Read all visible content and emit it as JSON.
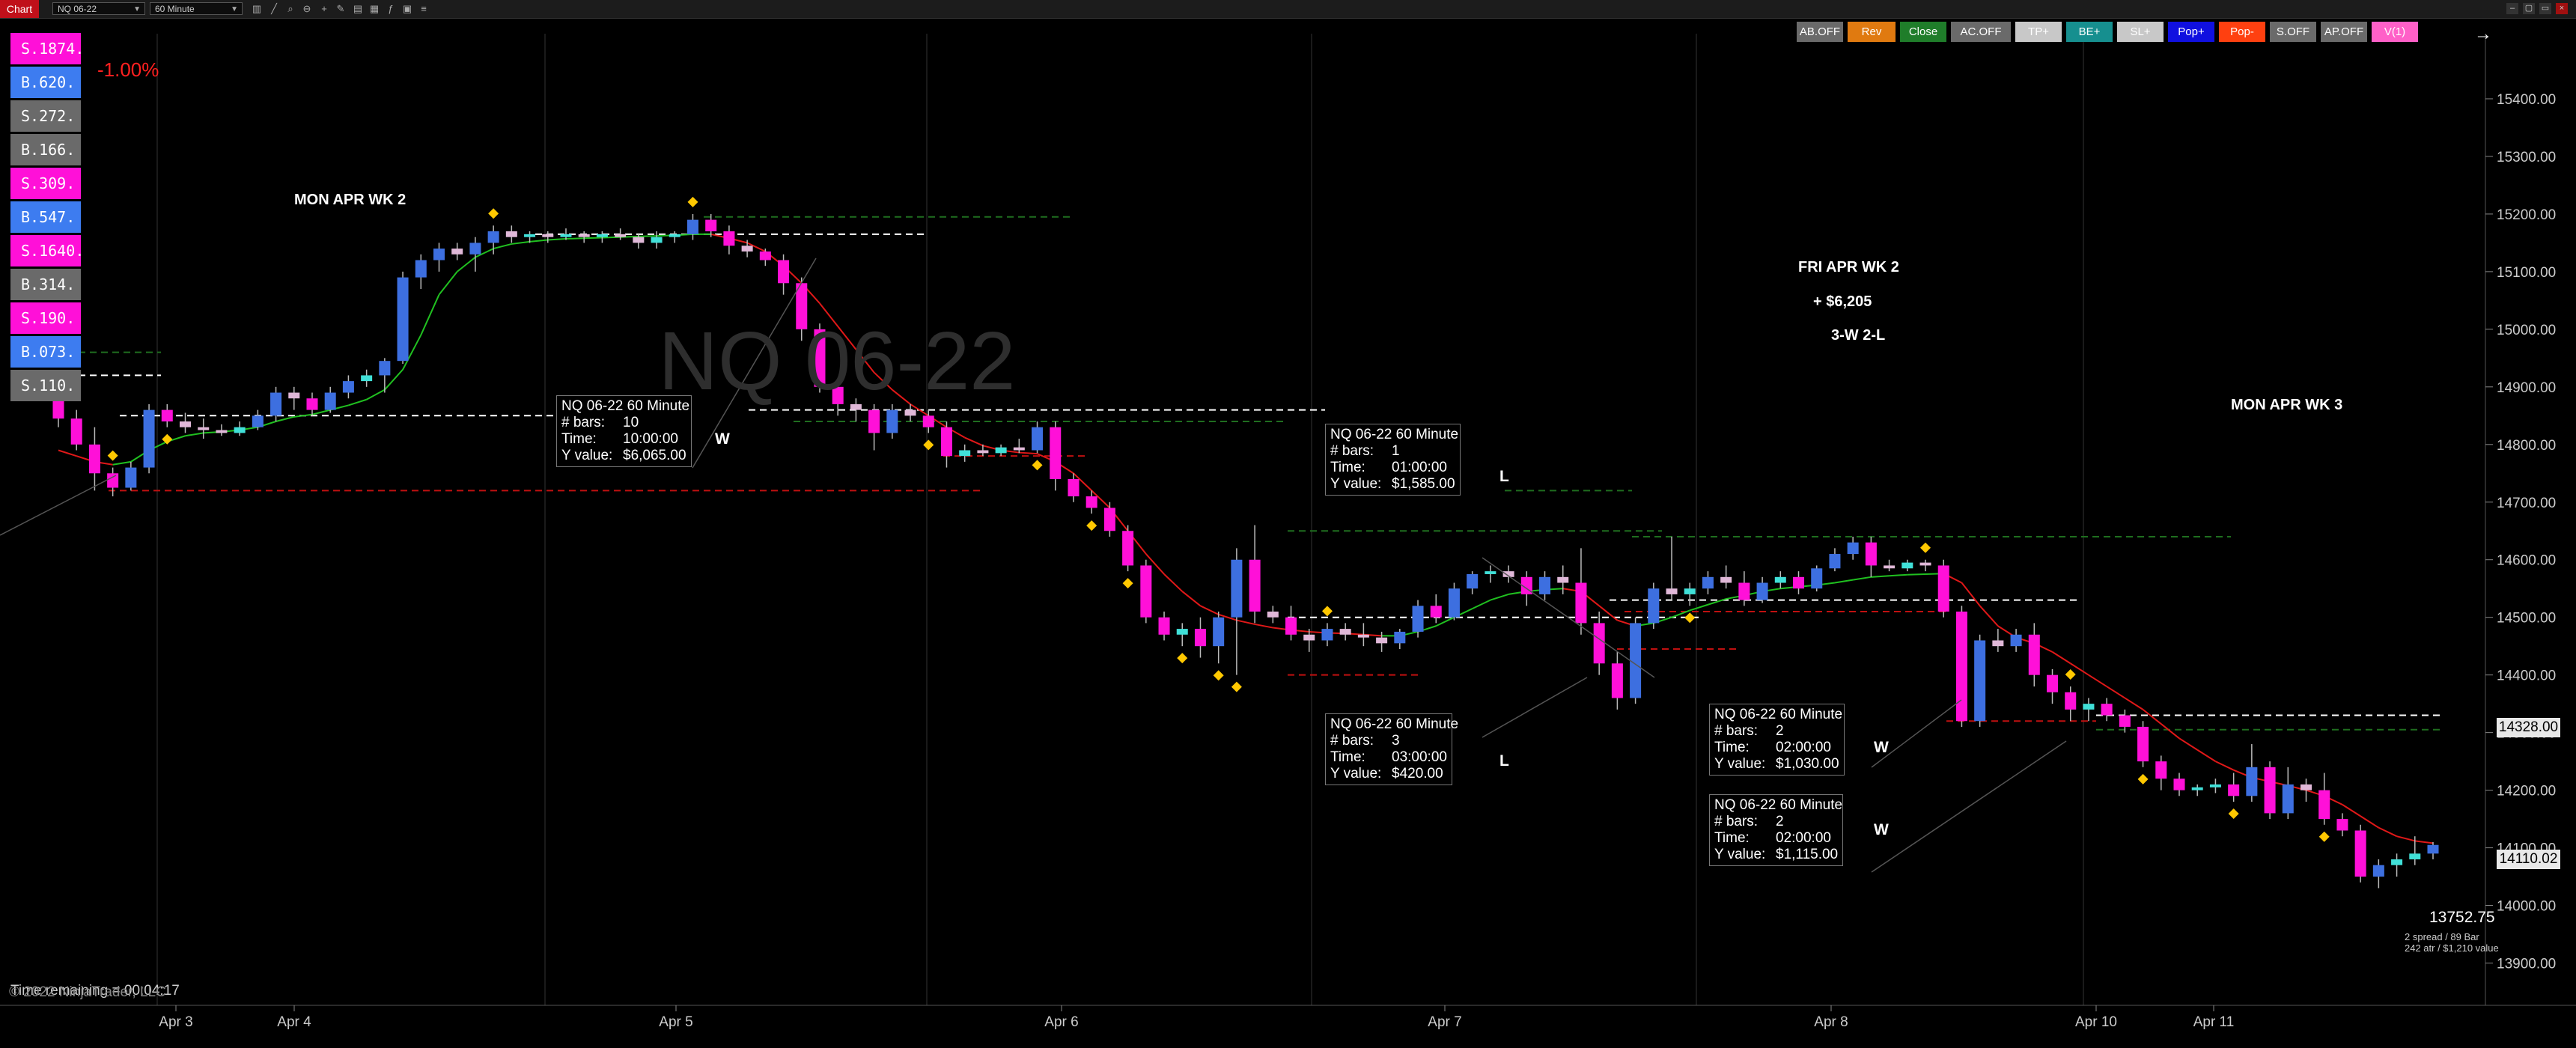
{
  "toolbar": {
    "tab": "Chart",
    "instrument": "NQ 06-22",
    "interval": "60 Minute"
  },
  "watermark": "NQ 06-22",
  "pnl_pct": "-1.00%",
  "positions": [
    {
      "label": "S.1874.",
      "color": "#ff10d8"
    },
    {
      "label": "B.620.",
      "color": "#3d7cf0"
    },
    {
      "label": "S.272.",
      "color": "#6a6a6a"
    },
    {
      "label": "B.166.",
      "color": "#6a6a6a"
    },
    {
      "label": "S.309.",
      "color": "#ff10d8"
    },
    {
      "label": "B.547.",
      "color": "#3d7cf0"
    },
    {
      "label": "S.1640.",
      "color": "#ff10d8"
    },
    {
      "label": "B.314.",
      "color": "#6a6a6a"
    },
    {
      "label": "S.190.",
      "color": "#ff10d8"
    },
    {
      "label": "B.073.",
      "color": "#3d7cf0"
    },
    {
      "label": "S.110.",
      "color": "#6a6a6a"
    }
  ],
  "trade_buttons": [
    {
      "label": "AB.OFF",
      "color": "#6a6a6a"
    },
    {
      "label": "Rev",
      "color": "#e07a10"
    },
    {
      "label": "Close",
      "color": "#1f7d2a"
    },
    {
      "label": "AC.OFF",
      "color": "#6a6a6a"
    },
    {
      "label": "TP+",
      "color": "#c8c8c8"
    },
    {
      "label": "BE+",
      "color": "#168f8f"
    },
    {
      "label": "SL+",
      "color": "#c8c8c8"
    },
    {
      "label": "Pop+",
      "color": "#1010e0"
    },
    {
      "label": "Pop-",
      "color": "#ff4010"
    },
    {
      "label": "S.OFF",
      "color": "#6a6a6a"
    },
    {
      "label": "AP.OFF",
      "color": "#6a6a6a"
    },
    {
      "label": "V(1)",
      "color": "#ff60c8"
    }
  ],
  "arrow_icon": "right-arrow",
  "notes": {
    "mon_apr_wk2": "MON APR WK 2",
    "fri_apr_wk2": "FRI APR WK 2",
    "fri_pnl": "+ $6,205",
    "fri_score": "3-W 2-L",
    "mon_apr_wk3": "MON APR WK 3"
  },
  "tooltips": [
    {
      "title": "NQ 06-22 60 Minute",
      "bars_label": "# bars:",
      "bars": "10",
      "time_label": "Time:",
      "time": "10:00:00",
      "y_label": "Y value:",
      "y": "$6,065.00",
      "result": "W"
    },
    {
      "title": "NQ 06-22 60 Minute",
      "bars_label": "# bars:",
      "bars": "1",
      "time_label": "Time:",
      "time": "01:00:00",
      "y_label": "Y value:",
      "y": "$1,585.00",
      "result": "L"
    },
    {
      "title": "NQ 06-22 60 Minute",
      "bars_label": "# bars:",
      "bars": "3",
      "time_label": "Time:",
      "time": "03:00:00",
      "y_label": "Y value:",
      "y": "$420.00",
      "result": "L"
    },
    {
      "title": "NQ 06-22 60 Minute",
      "bars_label": "# bars:",
      "bars": "2",
      "time_label": "Time:",
      "time": "02:00:00",
      "y_label": "Y value:",
      "y": "$1,030.00",
      "result": "W"
    },
    {
      "title": "NQ 06-22 60 Minute",
      "bars_label": "# bars:",
      "bars": "2",
      "time_label": "Time:",
      "time": "02:00:00",
      "y_label": "Y value:",
      "y": "$1,115.00",
      "result": "W"
    }
  ],
  "price_tags": {
    "level_1": "14328.00",
    "current": "14110.02",
    "low": "13752.75",
    "spread_info": "2 spread / 89 Bar",
    "atr_info": "242 atr / $1,210 value"
  },
  "footer": {
    "time_remaining": "Time remaining = 00:04:17",
    "copyright": "© 2022 NinjaTrader, LLC"
  },
  "colors": {
    "bull": "#3d6fe0",
    "bull_light": "#40e0d8",
    "bear": "#ff10d8",
    "bear_light": "#e0b8d8",
    "ema_red": "#e01818",
    "ema_green": "#20c020",
    "signal": "#ffc800"
  },
  "chart_data": {
    "type": "candlestick",
    "x_tick_labels": [
      "Apr 3",
      "Apr 4",
      "Apr 5",
      "Apr 6",
      "Apr 7",
      "Apr 8",
      "Apr 10",
      "Apr 11"
    ],
    "y_range": [
      13850,
      15500
    ],
    "y_tick_labels": [
      "15400.00",
      "15300.00",
      "15200.00",
      "15100.00",
      "15000.00",
      "14900.00",
      "14800.00",
      "14700.00",
      "14600.00",
      "14500.00",
      "14400.00",
      "14300.00",
      "14200.00",
      "14100.00",
      "14000.00",
      "13900.00"
    ],
    "grid": false,
    "candles": [
      [
        14880,
        14895,
        14830,
        14845
      ],
      [
        14845,
        14860,
        14790,
        14800
      ],
      [
        14800,
        14830,
        14720,
        14750
      ],
      [
        14750,
        14760,
        14710,
        14725
      ],
      [
        14725,
        14770,
        14720,
        14760
      ],
      [
        14760,
        14870,
        14750,
        14860
      ],
      [
        14860,
        14870,
        14830,
        14840
      ],
      [
        14840,
        14855,
        14820,
        14830
      ],
      [
        14830,
        14845,
        14810,
        14825
      ],
      [
        14825,
        14835,
        14815,
        14820
      ],
      [
        14820,
        14840,
        14815,
        14830
      ],
      [
        14830,
        14860,
        14825,
        14850
      ],
      [
        14850,
        14900,
        14840,
        14890
      ],
      [
        14890,
        14900,
        14860,
        14880
      ],
      [
        14880,
        14890,
        14850,
        14860
      ],
      [
        14860,
        14900,
        14855,
        14890
      ],
      [
        14890,
        14920,
        14880,
        14910
      ],
      [
        14910,
        14930,
        14900,
        14920
      ],
      [
        14920,
        14950,
        14890,
        14945
      ],
      [
        14945,
        15100,
        14940,
        15090
      ],
      [
        15090,
        15130,
        15070,
        15120
      ],
      [
        15120,
        15150,
        15100,
        15140
      ],
      [
        15140,
        15150,
        15120,
        15130
      ],
      [
        15130,
        15160,
        15100,
        15150
      ],
      [
        15150,
        15180,
        15130,
        15170
      ],
      [
        15170,
        15180,
        15150,
        15160
      ],
      [
        15160,
        15170,
        15150,
        15165
      ],
      [
        15165,
        15170,
        15150,
        15160
      ],
      [
        15160,
        15175,
        15155,
        15165
      ],
      [
        15165,
        15170,
        15150,
        15160
      ],
      [
        15160,
        15170,
        15150,
        15165
      ],
      [
        15165,
        15175,
        15155,
        15160
      ],
      [
        15160,
        15165,
        15140,
        15150
      ],
      [
        15150,
        15170,
        15140,
        15160
      ],
      [
        15160,
        15170,
        15150,
        15165
      ],
      [
        15165,
        15200,
        15155,
        15190
      ],
      [
        15190,
        15200,
        15160,
        15170
      ],
      [
        15170,
        15180,
        15130,
        15145
      ],
      [
        15145,
        15155,
        15125,
        15135
      ],
      [
        15135,
        15140,
        15110,
        15120
      ],
      [
        15120,
        15130,
        15060,
        15080
      ],
      [
        15080,
        15090,
        14980,
        15000
      ],
      [
        15000,
        15010,
        14890,
        14900
      ],
      [
        14900,
        14910,
        14850,
        14870
      ],
      [
        14870,
        14880,
        14840,
        14860
      ],
      [
        14860,
        14870,
        14790,
        14820
      ],
      [
        14820,
        14870,
        14810,
        14860
      ],
      [
        14860,
        14870,
        14840,
        14850
      ],
      [
        14850,
        14860,
        14820,
        14830
      ],
      [
        14830,
        14840,
        14760,
        14780
      ],
      [
        14780,
        14800,
        14770,
        14790
      ],
      [
        14790,
        14800,
        14780,
        14785
      ],
      [
        14785,
        14800,
        14780,
        14795
      ],
      [
        14795,
        14810,
        14785,
        14790
      ],
      [
        14790,
        14840,
        14785,
        14830
      ],
      [
        14830,
        14840,
        14720,
        14740
      ],
      [
        14740,
        14750,
        14700,
        14710
      ],
      [
        14710,
        14720,
        14680,
        14690
      ],
      [
        14690,
        14700,
        14640,
        14650
      ],
      [
        14650,
        14660,
        14580,
        14590
      ],
      [
        14590,
        14600,
        14490,
        14500
      ],
      [
        14500,
        14510,
        14460,
        14470
      ],
      [
        14470,
        14490,
        14450,
        14480
      ],
      [
        14480,
        14500,
        14430,
        14450
      ],
      [
        14450,
        14510,
        14420,
        14500
      ],
      [
        14500,
        14620,
        14400,
        14600
      ],
      [
        14600,
        14660,
        14490,
        14510
      ],
      [
        14510,
        14520,
        14490,
        14500
      ],
      [
        14500,
        14520,
        14460,
        14470
      ],
      [
        14470,
        14480,
        14440,
        14460
      ],
      [
        14460,
        14490,
        14450,
        14480
      ],
      [
        14480,
        14490,
        14460,
        14470
      ],
      [
        14470,
        14490,
        14450,
        14465
      ],
      [
        14465,
        14475,
        14440,
        14455
      ],
      [
        14455,
        14480,
        14445,
        14475
      ],
      [
        14475,
        14530,
        14465,
        14520
      ],
      [
        14520,
        14540,
        14490,
        14500
      ],
      [
        14500,
        14560,
        14495,
        14550
      ],
      [
        14550,
        14580,
        14540,
        14575
      ],
      [
        14575,
        14590,
        14560,
        14580
      ],
      [
        14580,
        14590,
        14560,
        14570
      ],
      [
        14570,
        14580,
        14520,
        14540
      ],
      [
        14540,
        14580,
        14530,
        14570
      ],
      [
        14570,
        14590,
        14540,
        14560
      ],
      [
        14560,
        14620,
        14470,
        14490
      ],
      [
        14490,
        14510,
        14400,
        14420
      ],
      [
        14420,
        14440,
        14340,
        14360
      ],
      [
        14360,
        14500,
        14350,
        14490
      ],
      [
        14490,
        14560,
        14480,
        14550
      ],
      [
        14550,
        14640,
        14530,
        14540
      ],
      [
        14540,
        14560,
        14520,
        14550
      ],
      [
        14550,
        14580,
        14540,
        14570
      ],
      [
        14570,
        14590,
        14550,
        14560
      ],
      [
        14560,
        14580,
        14520,
        14530
      ],
      [
        14530,
        14570,
        14525,
        14560
      ],
      [
        14560,
        14580,
        14550,
        14570
      ],
      [
        14570,
        14580,
        14540,
        14550
      ],
      [
        14550,
        14590,
        14545,
        14585
      ],
      [
        14585,
        14620,
        14580,
        14610
      ],
      [
        14610,
        14640,
        14600,
        14630
      ],
      [
        14630,
        14640,
        14570,
        14590
      ],
      [
        14590,
        14600,
        14580,
        14585
      ],
      [
        14585,
        14600,
        14580,
        14595
      ],
      [
        14595,
        14600,
        14580,
        14590
      ],
      [
        14590,
        14600,
        14500,
        14510
      ],
      [
        14510,
        14520,
        14310,
        14320
      ],
      [
        14320,
        14470,
        14310,
        14460
      ],
      [
        14460,
        14480,
        14440,
        14450
      ],
      [
        14450,
        14480,
        14440,
        14470
      ],
      [
        14470,
        14490,
        14380,
        14400
      ],
      [
        14400,
        14410,
        14350,
        14370
      ],
      [
        14370,
        14380,
        14320,
        14340
      ],
      [
        14340,
        14360,
        14320,
        14350
      ],
      [
        14350,
        14360,
        14320,
        14330
      ],
      [
        14330,
        14340,
        14300,
        14310
      ],
      [
        14310,
        14320,
        14240,
        14250
      ],
      [
        14250,
        14260,
        14200,
        14220
      ],
      [
        14220,
        14230,
        14190,
        14200
      ],
      [
        14200,
        14210,
        14190,
        14205
      ],
      [
        14205,
        14220,
        14195,
        14210
      ],
      [
        14210,
        14230,
        14180,
        14190
      ],
      [
        14190,
        14280,
        14180,
        14240
      ],
      [
        14240,
        14250,
        14150,
        14160
      ],
      [
        14160,
        14240,
        14150,
        14210
      ],
      [
        14210,
        14220,
        14180,
        14200
      ],
      [
        14200,
        14230,
        14140,
        14150
      ],
      [
        14150,
        14160,
        14120,
        14130
      ],
      [
        14130,
        14140,
        14040,
        14050
      ],
      [
        14050,
        14080,
        14030,
        14070
      ],
      [
        14070,
        14090,
        14050,
        14080
      ],
      [
        14080,
        14120,
        14070,
        14090
      ],
      [
        14090,
        14110,
        14080,
        14105
      ]
    ],
    "ema_points": [
      14790,
      14780,
      14770,
      14765,
      14770,
      14790,
      14805,
      14815,
      14820,
      14822,
      14825,
      14830,
      14840,
      14848,
      14852,
      14860,
      14868,
      14878,
      14895,
      14930,
      14990,
      15060,
      15100,
      15125,
      15140,
      15148,
      15152,
      15155,
      15157,
      15158,
      15159,
      15160,
      15161,
      15162,
      15163,
      15165,
      15165,
      15158,
      15150,
      15135,
      15110,
      15080,
      15045,
      15005,
      14965,
      14925,
      14895,
      14870,
      14850,
      14830,
      14812,
      14798,
      14790,
      14786,
      14784,
      14770,
      14750,
      14720,
      14690,
      14650,
      14610,
      14575,
      14545,
      14520,
      14505,
      14495,
      14488,
      14482,
      14478,
      14475,
      14473,
      14472,
      14470,
      14468,
      14468,
      14475,
      14485,
      14500,
      14515,
      14530,
      14540,
      14545,
      14548,
      14550,
      14545,
      14520,
      14495,
      14485,
      14490,
      14500,
      14512,
      14522,
      14532,
      14538,
      14545,
      14550,
      14553,
      14556,
      14560,
      14565,
      14570,
      14572,
      14574,
      14575,
      14576,
      14560,
      14520,
      14485,
      14465,
      14455,
      14440,
      14420,
      14400,
      14380,
      14360,
      14340,
      14315,
      14290,
      14270,
      14250,
      14235,
      14222,
      14215,
      14208,
      14200,
      14190,
      14175,
      14155,
      14135,
      14120,
      14112,
      14108
    ],
    "ema_colors": "green when rising, red when falling",
    "signals_up": [
      3,
      24,
      35,
      70,
      103,
      111
    ],
    "signals_down": [
      6,
      48,
      54,
      57,
      59,
      62,
      64,
      65,
      90,
      115,
      120,
      125
    ]
  }
}
